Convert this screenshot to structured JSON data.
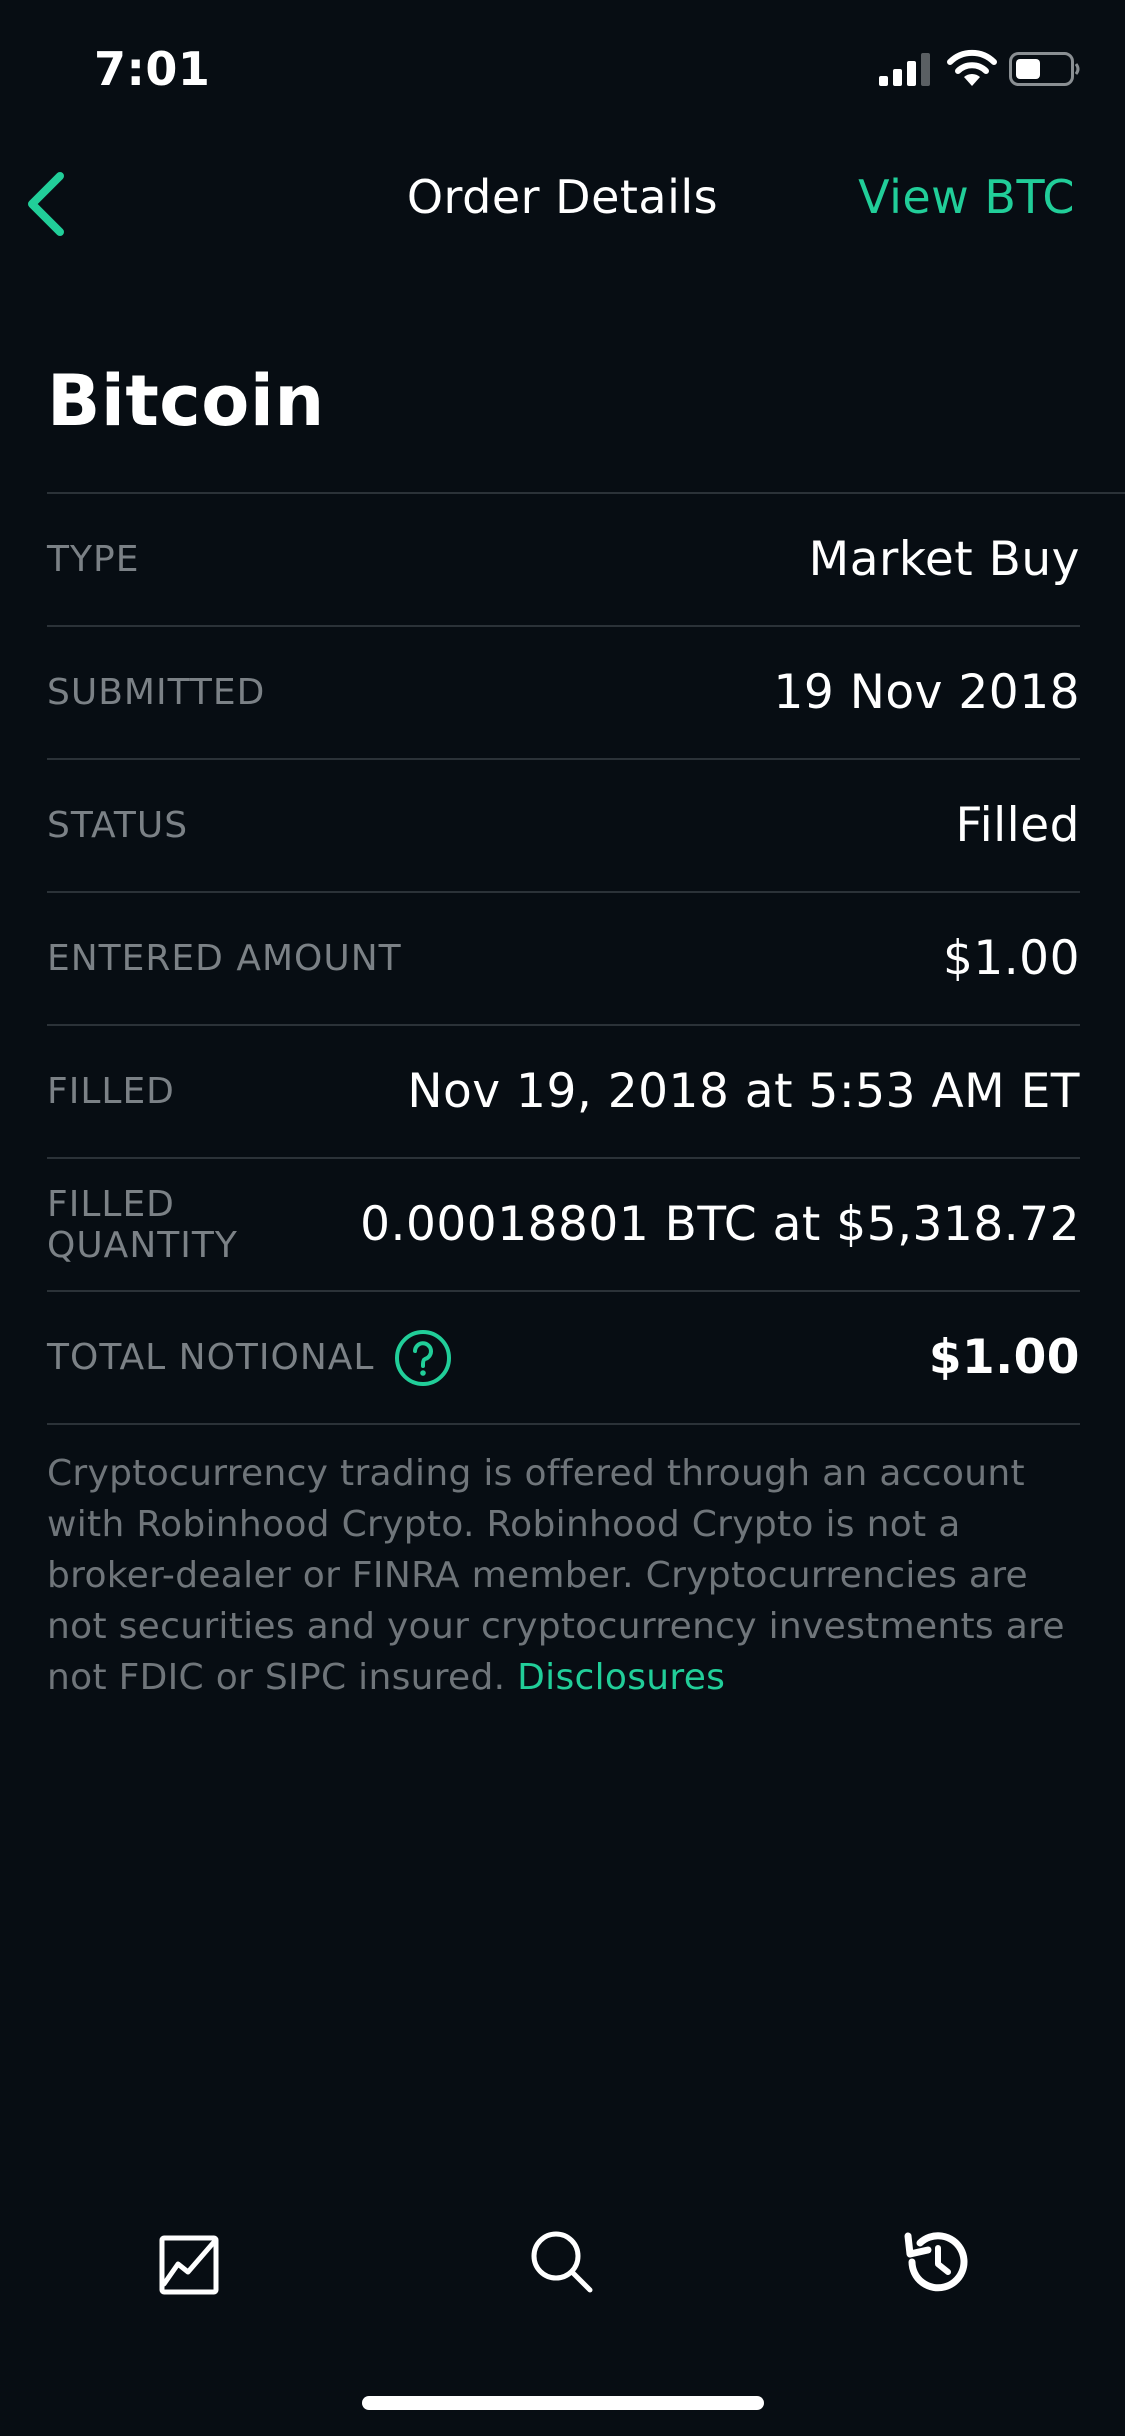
{
  "status_bar": {
    "time": "7:01"
  },
  "nav": {
    "title": "Order Details",
    "action": "View BTC"
  },
  "asset": {
    "name": "Bitcoin"
  },
  "details": [
    {
      "label": "TYPE",
      "value": "Market Buy"
    },
    {
      "label": "SUBMITTED",
      "value": "19 Nov 2018"
    },
    {
      "label": "STATUS",
      "value": "Filled"
    },
    {
      "label": "ENTERED AMOUNT",
      "value": "$1.00"
    },
    {
      "label": "FILLED",
      "value": "Nov 19, 2018 at 5:53 AM ET"
    },
    {
      "label": "FILLED QUANTITY",
      "value": "0.00018801 BTC at $5,318.72"
    },
    {
      "label": "TOTAL NOTIONAL",
      "value": "$1.00"
    }
  ],
  "disclaimer": {
    "text": "Cryptocurrency trading is offered through an account with Robinhood Crypto. Robinhood Crypto is not a broker-dealer or FINRA member. Cryptocurrencies are not securities and your cryptocurrency investments are not FDIC or SIPC insured. ",
    "link": "Disclosures"
  },
  "tab_bar": {
    "icons": [
      "portfolio-chart-icon",
      "search-icon",
      "history-icon"
    ]
  },
  "colors": {
    "background": "#070d13",
    "accent": "#21ce99",
    "label": "#7b8186",
    "divider": "#2b3238"
  }
}
